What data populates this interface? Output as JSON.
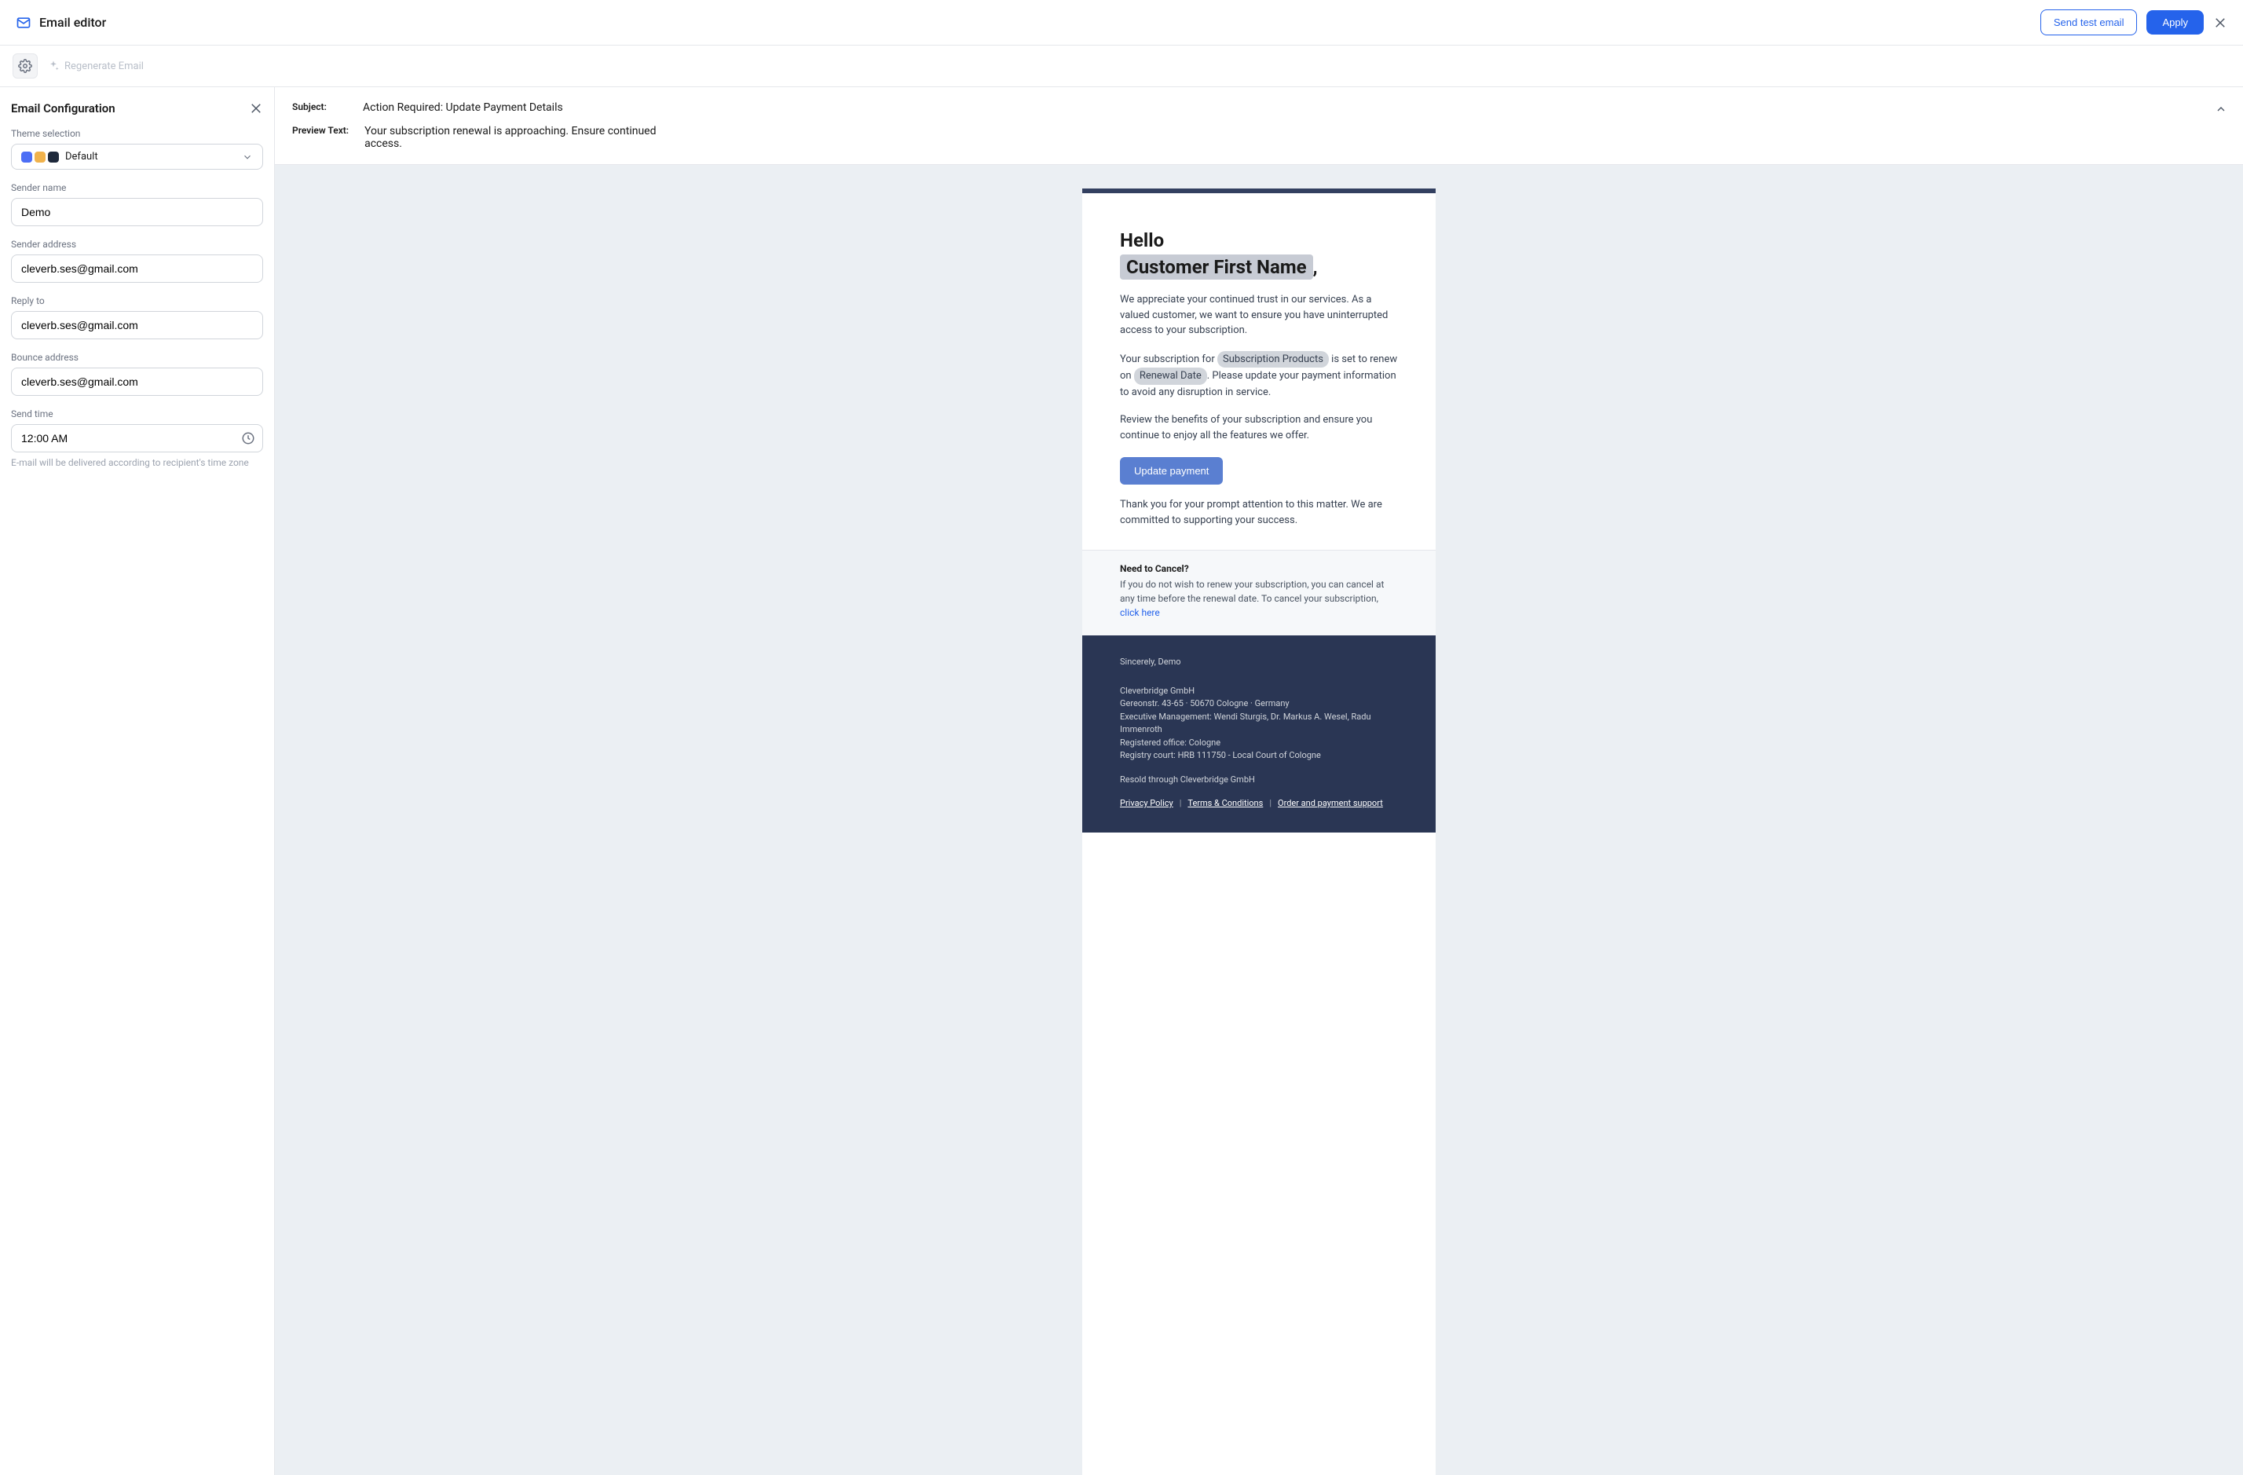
{
  "topbar": {
    "title": "Email editor",
    "send_test": "Send test email",
    "apply": "Apply"
  },
  "regen": {
    "label": "Regenerate Email"
  },
  "config": {
    "heading": "Email Configuration",
    "theme_label": "Theme selection",
    "theme_value": "Default",
    "sender_name_label": "Sender name",
    "sender_name_value": "Demo",
    "sender_addr_label": "Sender address",
    "sender_addr_value": "cleverb.ses@gmail.com",
    "reply_to_label": "Reply to",
    "reply_to_value": "cleverb.ses@gmail.com",
    "bounce_label": "Bounce address",
    "bounce_value": "cleverb.ses@gmail.com",
    "send_time_label": "Send time",
    "send_time_value": "12:00 AM",
    "send_time_hint": "E-mail will be delivered according to recipient's time zone"
  },
  "meta": {
    "subject_label": "Subject:",
    "subject_value": "Action Required: Update Payment Details",
    "preview_label": "Preview Text:",
    "preview_value": "Your subscription renewal is approaching. Ensure continued access."
  },
  "email": {
    "greet": "Hello",
    "name_placeholder": "Customer First Name",
    "comma": ",",
    "p1": "We appreciate your continued trust in our services. As a valued customer, we want to ensure you have uninterrupted access to your subscription.",
    "p2a": "Your subscription for ",
    "pill_products": "Subscription Products",
    "p2b": " is set to renew on ",
    "pill_date": "Renewal Date",
    "p2c": ". Please update your payment information to avoid any disruption in service.",
    "p3": "Review the benefits of your subscription and ensure you continue to enjoy all the features we offer.",
    "cta": "Update payment",
    "p4": "Thank you for your prompt attention to this matter. We are committed to supporting your success.",
    "cancel_head": "Need to Cancel?",
    "cancel_txt": "If you do not wish to renew your subscription, you can cancel at any time before the renewal date. To cancel your subscription, ",
    "cancel_link": "click here",
    "sign": "Sincerely, Demo",
    "company": "Cleverbridge GmbH",
    "addr": "Gereonstr. 43-65 · 50670 Cologne · Germany",
    "mgmt": "Executive Management: Wendi Sturgis, Dr. Markus A. Wesel, Radu Immenroth",
    "office": "Registered office: Cologne",
    "court": "Registry court: HRB 111750 - Local Court of Cologne",
    "resold": "Resold through Cleverbridge GmbH",
    "link_privacy": "Privacy Policy",
    "link_terms": "Terms & Conditions",
    "link_support": "Order and payment support"
  }
}
